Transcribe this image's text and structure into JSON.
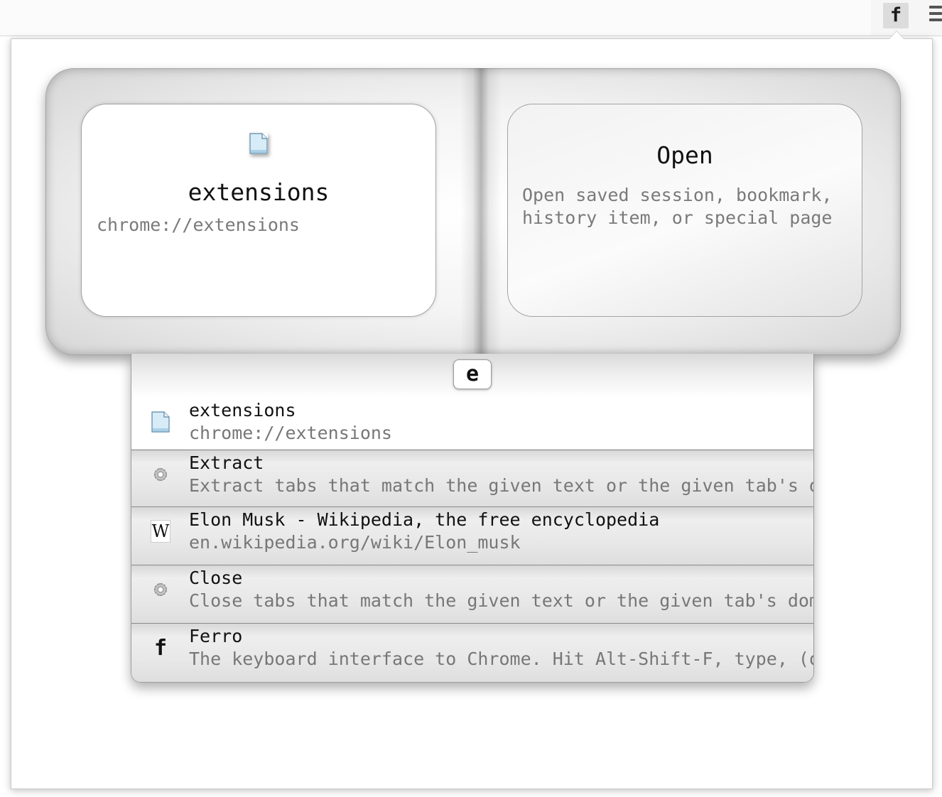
{
  "toolbar": {
    "extension_label": "f",
    "menu_icon": "hamburger-icon"
  },
  "preview": {
    "current": {
      "icon": "document-icon",
      "title": "extensions",
      "url": "chrome://extensions"
    },
    "action": {
      "title": "Open",
      "description": "Open saved session, bookmark, history item, or special page"
    }
  },
  "query": {
    "text": "e"
  },
  "results": [
    {
      "icon": "document-icon",
      "title": "extensions",
      "subtitle": "chrome://extensions",
      "selected": true
    },
    {
      "icon": "gear-icon",
      "title": "Extract",
      "subtitle": "Extract tabs that match the given text or the given tab's domain"
    },
    {
      "icon": "wikipedia-icon",
      "icon_text": "W",
      "title": "Elon Musk - Wikipedia, the free encyclopedia",
      "subtitle": "en.wikipedia.org/wiki/Elon_musk"
    },
    {
      "icon": "gear-icon",
      "title": "Close",
      "subtitle": "Close tabs that match the given text or the given tab's domain"
    },
    {
      "icon": "ferro-icon",
      "icon_text": "f",
      "title": "Ferro",
      "subtitle": "The keyboard interface to Chrome. Hit Alt-Shift-F, type, (optional"
    }
  ]
}
